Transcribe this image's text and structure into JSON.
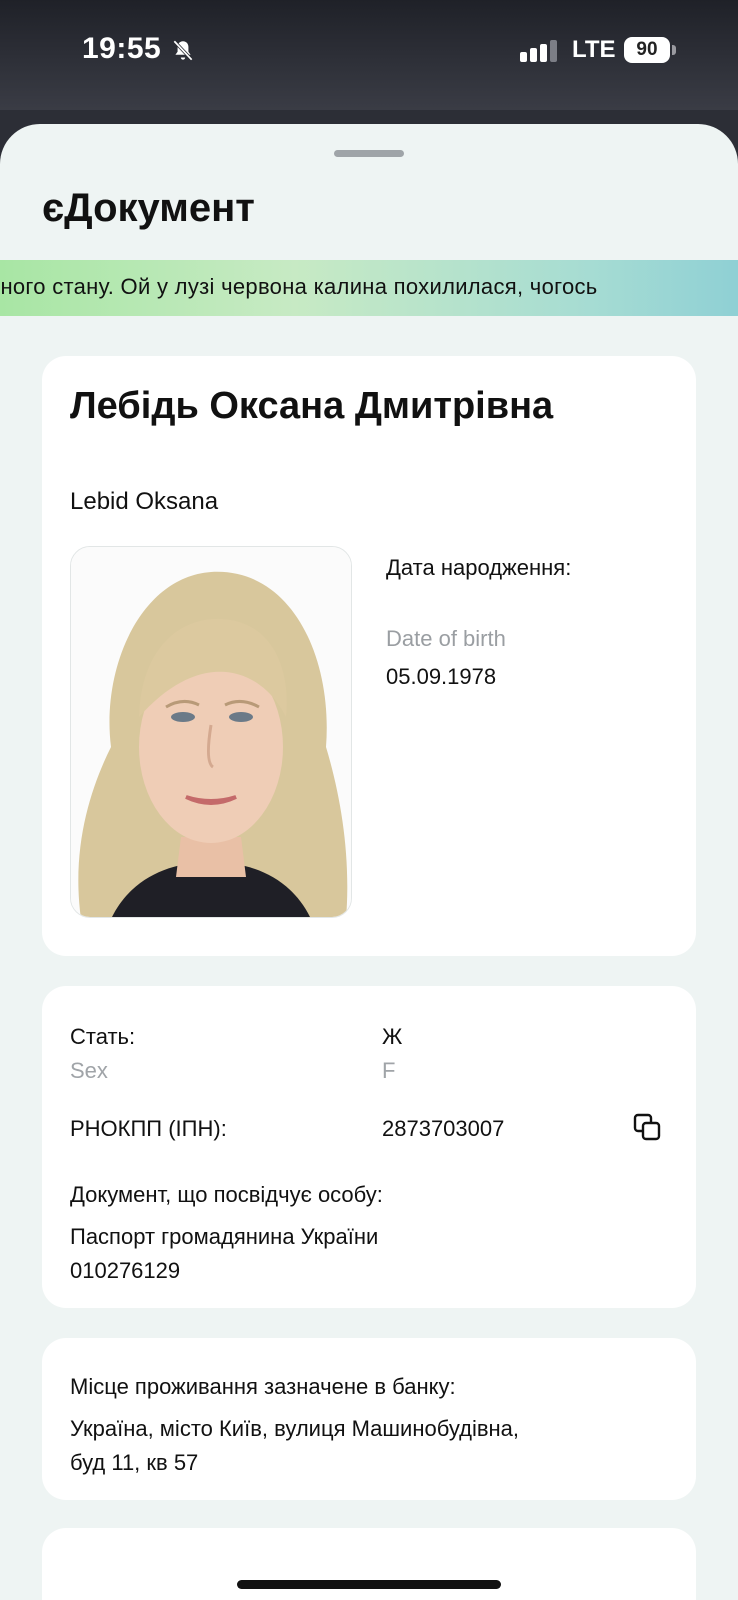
{
  "status_bar": {
    "time": "19:55",
    "network": "LTE",
    "battery": "90",
    "icons": [
      "bell-off-icon",
      "signal-icon"
    ]
  },
  "header": {
    "title": "єДокумент"
  },
  "ticker": {
    "text": "нного стану. Ой у лузі червона калина похилилася, чогось"
  },
  "person": {
    "name_uk": "Лебідь Оксана Дмитрівна",
    "name_en": "Lebid Oksana",
    "dob_label": "Дата народження:",
    "dob_label_en": "Date of birth",
    "dob_value": "05.09.1978"
  },
  "info": {
    "sex_label": "Стать:",
    "sex_label_en": "Sex",
    "sex_value": "Ж",
    "sex_value_en": "F",
    "rnokpp_label": "РНОКПП (ІПН):",
    "rnokpp_value": "2873703007",
    "doc_label": "Документ, що посвідчує особу:",
    "doc_type": "Паспорт громадянина України",
    "doc_number": "010276129"
  },
  "address": {
    "label": "Місце проживання зазначене в банку:",
    "line1": "Україна, місто Київ, вулиця Машинобудівна,",
    "line2": "буд 11, кв 57"
  },
  "colors": {
    "sheet_bg": "#eef4f3",
    "card_bg": "#ffffff",
    "ticker_gradient_start": "#a8e6a4",
    "ticker_gradient_end": "#8fd0d4",
    "muted_text": "#9a9ea2"
  }
}
